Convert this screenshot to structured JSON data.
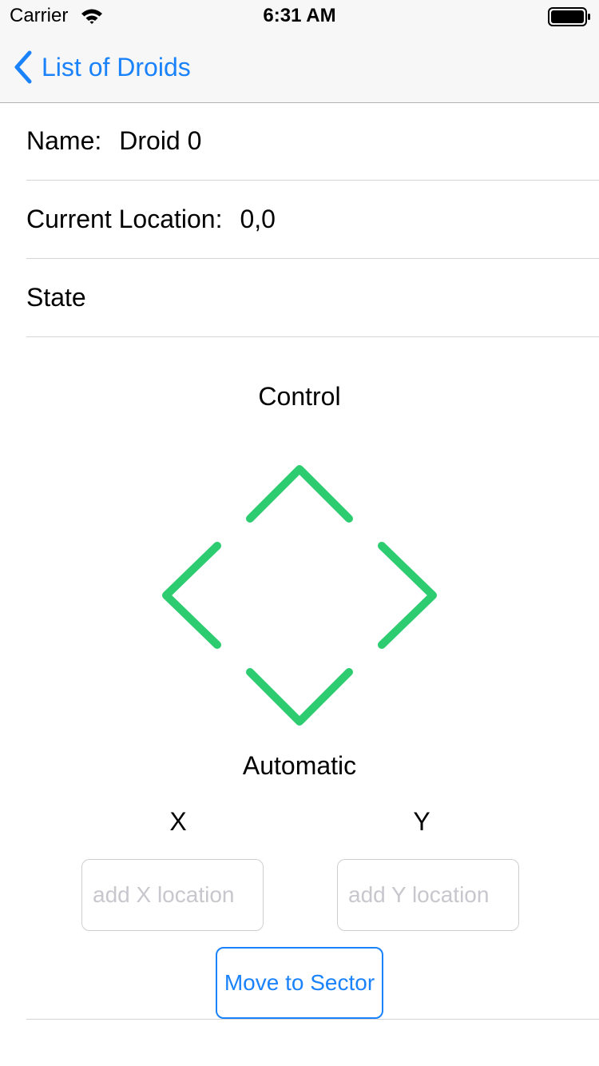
{
  "status_bar": {
    "carrier": "Carrier",
    "time": "6:31 AM"
  },
  "nav": {
    "back_label": "List of Droids",
    "back_icon": "chevron-left-icon",
    "accent_color": "#1a82fb"
  },
  "details": {
    "name_label": "Name:",
    "name_value": "Droid 0",
    "location_label": "Current Location:",
    "location_value": "0,0",
    "state_label": "State"
  },
  "control": {
    "title": "Control",
    "arrow_color": "#2ecc71",
    "buttons": [
      "up-arrow-icon",
      "left-arrow-icon",
      "right-arrow-icon",
      "down-arrow-icon"
    ]
  },
  "automatic": {
    "title": "Automatic",
    "x_label": "X",
    "y_label": "Y",
    "x_placeholder": "add X location",
    "y_placeholder": "add Y location",
    "x_value": "",
    "y_value": "",
    "submit_label": "Move to Sector"
  }
}
